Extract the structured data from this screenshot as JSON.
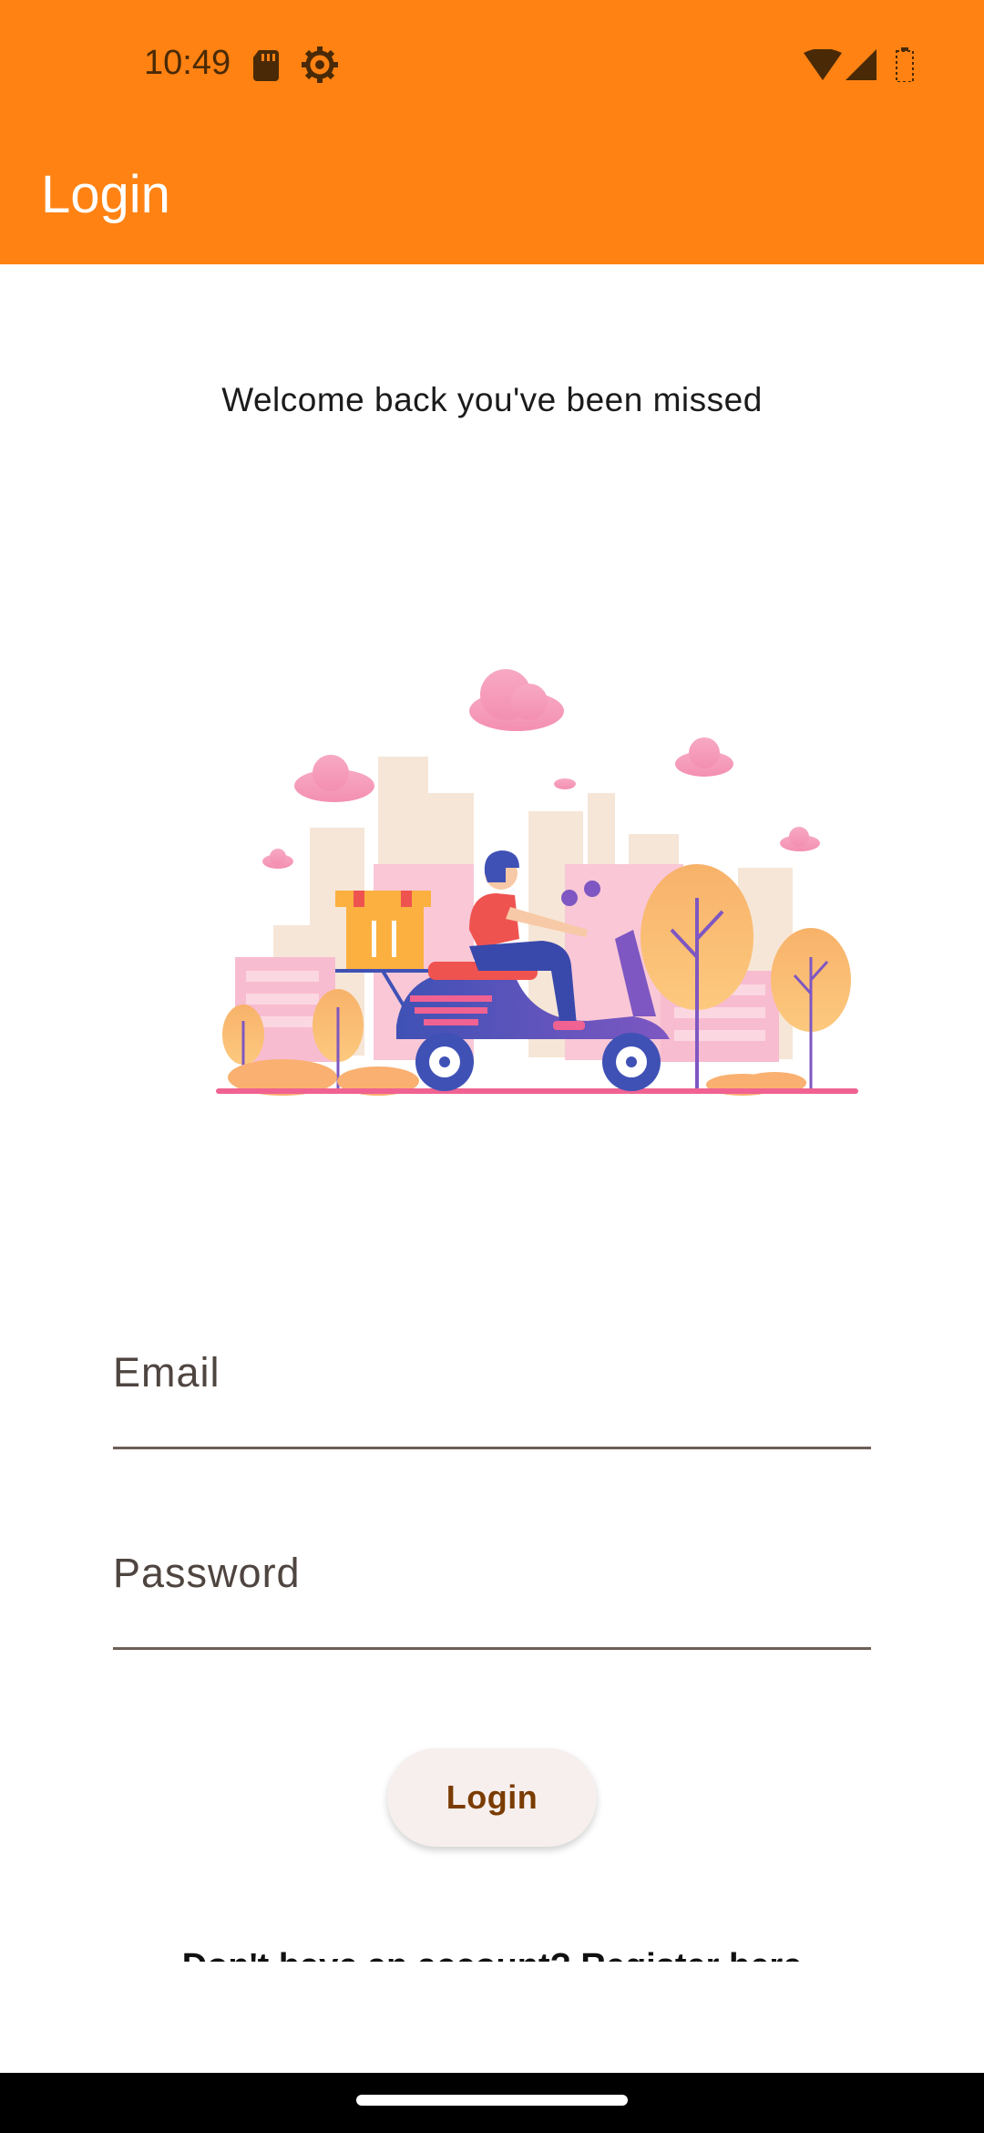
{
  "status_bar": {
    "time": "10:49",
    "icons": [
      "sd-card-icon",
      "settings-gear-icon",
      "wifi-icon",
      "cell-signal-icon",
      "battery-icon"
    ]
  },
  "app_bar": {
    "title": "Login"
  },
  "main": {
    "welcome_text": "Welcome back you've been missed",
    "illustration": "food-delivery-scooter-illustration",
    "email_label": "Email",
    "password_label": "Password",
    "login_button_label": "Login",
    "register_text": "Don't have an account? Register here"
  },
  "colors": {
    "primary": "#FF8213",
    "button_bg": "#F7EFEE",
    "button_text": "#7A3C00"
  }
}
